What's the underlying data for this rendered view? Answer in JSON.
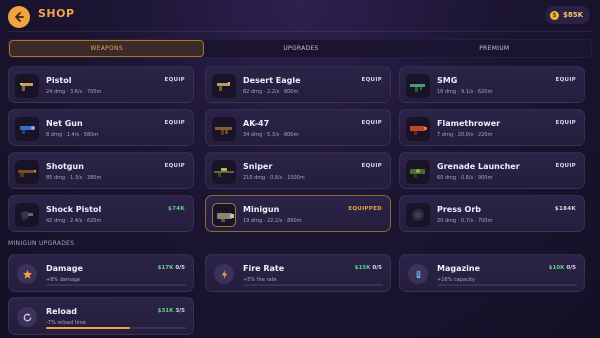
{
  "header": {
    "title": "SHOP",
    "currency": "$85K",
    "coin_symbol": "$"
  },
  "tabs": [
    "WEAPONS",
    "UPGRADES",
    "PREMIUM"
  ],
  "weapons": [
    {
      "name": "Pistol",
      "stats": "24 dmg · 3.6/s · 700m",
      "action": "EQUIP"
    },
    {
      "name": "Desert Eagle",
      "stats": "82 dmg · 2.2/s · 800m",
      "action": "EQUIP"
    },
    {
      "name": "SMG",
      "stats": "16 dmg · 9.1/s · 620m",
      "action": "EQUIP"
    },
    {
      "name": "Net Gun",
      "stats": "8 dmg · 1.4/s · 580m",
      "action": "EQUIP"
    },
    {
      "name": "AK-47",
      "stats": "34 dmg · 5.3/s · 800m",
      "action": "EQUIP"
    },
    {
      "name": "Flamethrower",
      "stats": "7 dmg · 20.0/s · 220m",
      "action": "EQUIP"
    },
    {
      "name": "Shotgun",
      "stats": "85 dmg · 1.3/s · 380m",
      "action": "EQUIP"
    },
    {
      "name": "Sniper",
      "stats": "210 dmg · 0.8/s · 1500m",
      "action": "EQUIP"
    },
    {
      "name": "Grenade Launcher",
      "stats": "60 dmg · 0.8/s · 900m",
      "action": "EQUIP"
    },
    {
      "name": "Shock Pistol",
      "stats": "42 dmg · 2.4/s · 620m",
      "action": "$74K"
    },
    {
      "name": "Minigun",
      "stats": "19 dmg · 22.2/s · 890m",
      "action": "EQUIPPED"
    },
    {
      "name": "Press Orb",
      "stats": "20 dmg · 0.7/s · 700m",
      "action": "$184K"
    }
  ],
  "section_label": "MINIGUN UPGRADES",
  "upgrades": [
    {
      "name": "Damage",
      "desc": "+8% damage",
      "price": "$17K",
      "level": "0/5",
      "icon": "star-icon",
      "progress": 0
    },
    {
      "name": "Fire Rate",
      "desc": "+5% fire rate",
      "price": "$15K",
      "level": "0/5",
      "icon": "lightning-icon",
      "progress": 0
    },
    {
      "name": "Magazine",
      "desc": "+16% capacity",
      "price": "$10K",
      "level": "0/5",
      "icon": "magazine-icon",
      "progress": 0
    },
    {
      "name": "Reload",
      "desc": "-7% reload time",
      "price": "$31K",
      "level": "3/5",
      "icon": "reload-icon",
      "progress": 0.6
    }
  ],
  "colors": {
    "accent": "#f0a340",
    "price_green": "#5fd17b",
    "background": "#1c1533",
    "card": "#2a2245"
  }
}
